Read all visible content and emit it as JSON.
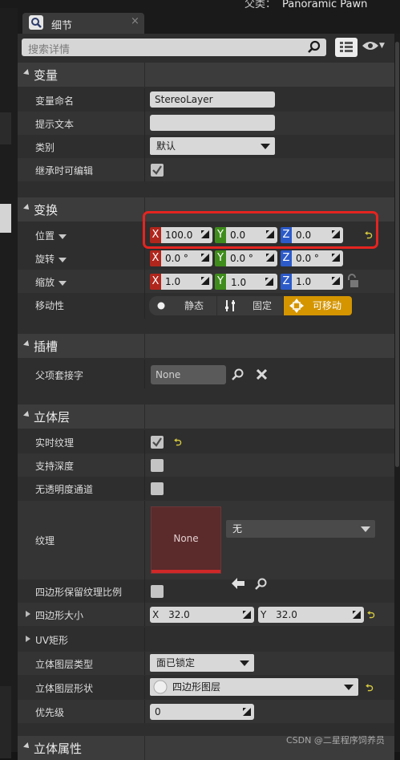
{
  "header": {
    "class_label": "父类：",
    "class_value": "Panoramic Pawn"
  },
  "tab": {
    "label": "细节",
    "close": "×"
  },
  "search": {
    "placeholder": "搜索详情"
  },
  "categories": {
    "variable": "变量",
    "transform": "变换",
    "socket": "插槽",
    "stereo": "立体层",
    "stereo_props": "立体属性"
  },
  "variable": {
    "name_label": "变量命名",
    "name_value": "StereoLayer",
    "tooltip_label": "提示文本",
    "tooltip_value": "",
    "category_label": "类别",
    "category_value": "默认",
    "inherit_label": "继承时可编辑",
    "inherit_checked": true
  },
  "transform": {
    "location_label": "位置",
    "location": {
      "x": "100.0",
      "y": "0.0",
      "z": "0.0"
    },
    "rotation_label": "旋转",
    "rotation": {
      "x": "0.0 °",
      "y": "0.0 °",
      "z": "0.0 °"
    },
    "scale_label": "缩放",
    "scale": {
      "x": "1.0",
      "y": "1.0",
      "z": "1.0"
    },
    "mobility_label": "移动性",
    "mobility": {
      "static": "静态",
      "stationary": "固定",
      "movable": "可移动",
      "selected": "可移动"
    }
  },
  "socket": {
    "parent_label": "父项套接字",
    "parent_value": "None"
  },
  "stereo": {
    "live_texture_label": "实时纹理",
    "live_texture_checked": true,
    "support_depth_label": "支持深度",
    "support_depth_checked": false,
    "no_alpha_label": "无透明度通道",
    "no_alpha_checked": false,
    "texture_label": "纹理",
    "texture_thumb": "None",
    "texture_combo": "无",
    "quad_keep_ratio_label": "四边形保留纹理比例",
    "quad_keep_ratio_checked": false,
    "quad_size_label": "四边形大小",
    "quad_size": {
      "x": "32.0",
      "y": "32.0"
    },
    "uv_rect_label": "UV矩形",
    "layer_type_label": "立体图层类型",
    "layer_type_value": "面已锁定",
    "layer_shape_label": "立体图层形状",
    "layer_shape_value": "四边形图层",
    "priority_label": "优先级",
    "priority_value": "0"
  },
  "colors": {
    "highlight": "#e52420",
    "mobility_active": "#d49500",
    "axis_x": "#b1261c",
    "axis_y": "#3f8c1c",
    "axis_z": "#2c5ac8"
  },
  "watermark": "CSDN @二星程序饲养员"
}
